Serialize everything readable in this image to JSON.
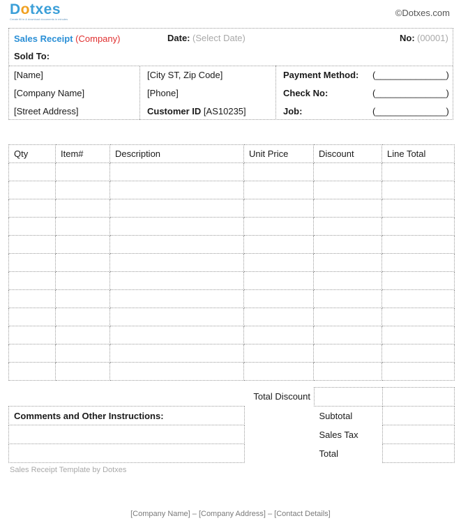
{
  "brand": {
    "logo_prefix": "D",
    "logo_o": "o",
    "logo_suffix": "txes",
    "tagline": "Create fill in & download documents in minutes",
    "copyright": "©Dotxes.com"
  },
  "header": {
    "title": "Sales Receipt",
    "company": "(Company)",
    "date_label": "Date:",
    "date_value": "(Select Date)",
    "no_label": "No:",
    "no_value": "(00001)",
    "sold_to": "Sold To:"
  },
  "customer": {
    "name": "[Name]",
    "company_name": "[Company Name]",
    "street": "[Street Address]",
    "city": "[City ST, Zip Code]",
    "phone": "[Phone]",
    "customer_id_label": "Customer ID",
    "customer_id_value": "[AS10235]"
  },
  "payment": {
    "method_label": "Payment Method:",
    "method_value": "(______________)",
    "check_label": "Check No:",
    "check_value": "(______________)",
    "job_label": "Job:",
    "job_value": "(______________)"
  },
  "items_table": {
    "headers": [
      "Qty",
      "Item#",
      "Description",
      "Unit Price",
      "Discount",
      "Line Total"
    ]
  },
  "totals": {
    "total_discount": "Total Discount",
    "comments": "Comments and Other Instructions:",
    "subtotal": "Subtotal",
    "sales_tax": "Sales Tax",
    "total": "Total"
  },
  "footer": {
    "template_credit": "Sales Receipt Template  by Dotxes",
    "company_line": "[Company Name] – [Company Address] – [Contact Details]"
  }
}
